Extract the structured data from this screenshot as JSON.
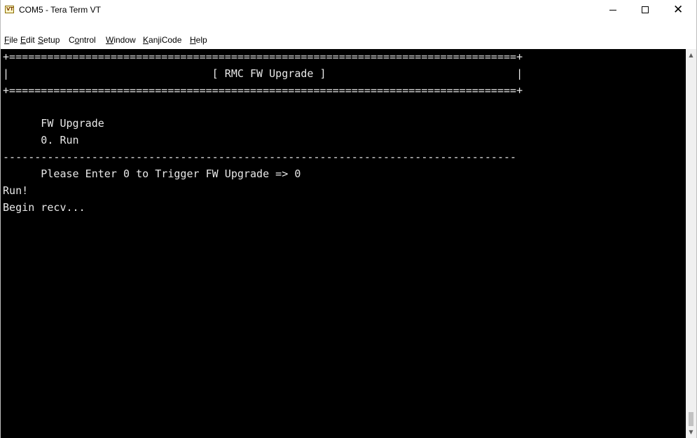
{
  "window": {
    "title": "COM5 - Tera Term VT",
    "app_icon_text": "VT",
    "controls": {
      "minimize": "minimize-icon",
      "maximize": "maximize-icon",
      "close": "close-icon"
    }
  },
  "menu": {
    "items": [
      {
        "mnemonic": "F",
        "rest": "ile"
      },
      {
        "mnemonic": "E",
        "rest": "dit"
      },
      {
        "mnemonic": "S",
        "rest": "etup"
      },
      {
        "pre": "C",
        "mnemonic": "o",
        "rest": "ntrol"
      },
      {
        "mnemonic": "W",
        "rest": "indow"
      },
      {
        "mnemonic": "K",
        "rest": "anjiCode"
      },
      {
        "mnemonic": "H",
        "rest": "elp"
      }
    ]
  },
  "terminal": {
    "background": "#000000",
    "foreground": "#e8e8e8",
    "lines": [
      "+================================================================================+",
      "|                                [ RMC FW Upgrade ]                              |",
      "+================================================================================+",
      "",
      "",
      "      FW Upgrade",
      "      0. Run",
      "---------------------------------------------------------------------------------",
      "      Please Enter 0 to Trigger FW Upgrade => 0",
      "Run!",
      "Begin recv..."
    ]
  },
  "scrollbar": {
    "up_icon": "scroll-up-arrow-icon",
    "down_icon": "scroll-down-arrow-icon"
  }
}
